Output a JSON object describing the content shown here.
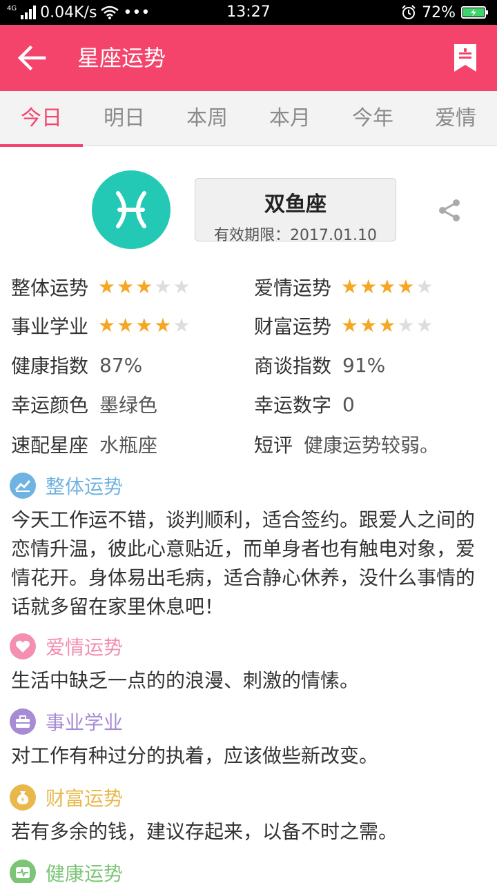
{
  "status_bar": {
    "network_type": "4G",
    "speed": "0.04K/s",
    "more": "•••",
    "time": "13:27",
    "battery": "72%"
  },
  "app_bar": {
    "title": "星座运势",
    "back_icon": "arrow-left-icon",
    "bookmark_icon": "bookmark-icon"
  },
  "tabs": [
    {
      "label": "今日",
      "active": true
    },
    {
      "label": "明日",
      "active": false
    },
    {
      "label": "本周",
      "active": false
    },
    {
      "label": "本月",
      "active": false
    },
    {
      "label": "今年",
      "active": false
    },
    {
      "label": "爱情",
      "active": false
    }
  ],
  "sign": {
    "name": "双鱼座",
    "valid": "有效期限：2017.01.10",
    "icon": "pisces-icon",
    "share_icon": "share-icon"
  },
  "stats": {
    "overall": {
      "label": "整体运势",
      "stars": 3,
      "max": 5
    },
    "love": {
      "label": "爱情运势",
      "stars": 4,
      "max": 5
    },
    "career": {
      "label": "事业学业",
      "stars": 4,
      "max": 5
    },
    "wealth": {
      "label": "财富运势",
      "stars": 3,
      "max": 5
    },
    "health": {
      "label": "健康指数",
      "value": "87%"
    },
    "negotiation": {
      "label": "商谈指数",
      "value": "91%"
    },
    "lucky_color": {
      "label": "幸运颜色",
      "value": "墨绿色"
    },
    "lucky_number": {
      "label": "幸运数字",
      "value": "0"
    },
    "match": {
      "label": "速配星座",
      "value": "水瓶座"
    },
    "review": {
      "label": "短评",
      "value": "健康运势较弱。"
    }
  },
  "sections": [
    {
      "title": "整体运势",
      "icon": "trend-chart-icon",
      "color": "#6fb3e0",
      "text": "今天工作运不错，谈判顺利，适合签约。跟爱人之间的恋情升温，彼此心意贴近，而单身者也有触电对象，爱情花开。身体易出毛病，适合静心休养，没什么事情的话就多留在家里休息吧！"
    },
    {
      "title": "爱情运势",
      "icon": "heart-icon",
      "color": "#f48fb1",
      "text": "生活中缺乏一点的的浪漫、刺激的情愫。"
    },
    {
      "title": "事业学业",
      "icon": "briefcase-icon",
      "color": "#a78bd4",
      "text": "对工作有种过分的执着，应该做些新改变。"
    },
    {
      "title": "财富运势",
      "icon": "money-bag-icon",
      "color": "#e8b84a",
      "text": "若有多余的钱，建议存起来，以备不时之需。"
    },
    {
      "title": "健康运势",
      "icon": "heartbeat-icon",
      "color": "#7cc576",
      "text": ""
    }
  ],
  "colors": {
    "brand": "#f4446c",
    "star_on": "#f5a623",
    "star_off": "#dddddd",
    "sign_circle": "#23c9b4"
  }
}
